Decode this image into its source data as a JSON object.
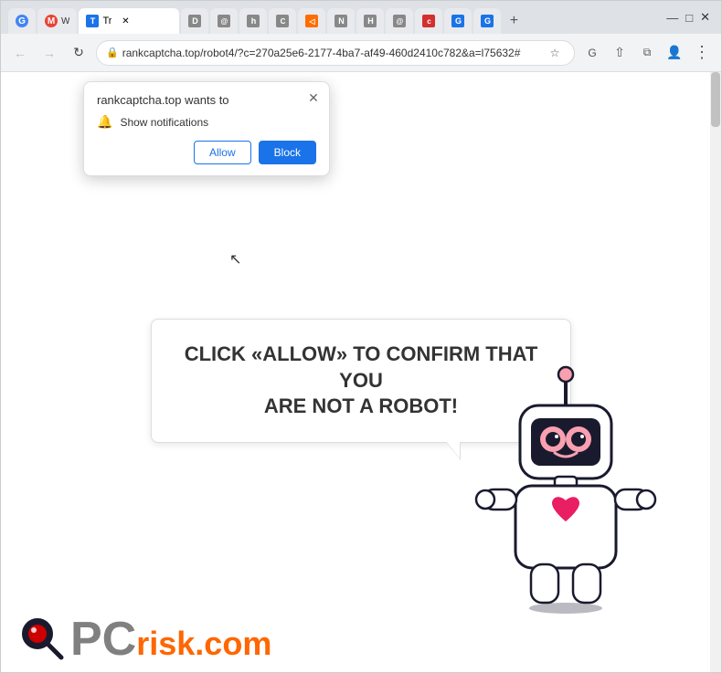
{
  "browser": {
    "tabs": [
      {
        "id": "tab-google",
        "label": "G W",
        "favicon": "G",
        "fav_type": "fav-g",
        "active": false
      },
      {
        "id": "tab-mw",
        "label": "M W",
        "favicon": "M",
        "fav_type": "fav-m",
        "active": false
      },
      {
        "id": "tab-active",
        "label": "Tr",
        "favicon": "T",
        "fav_type": "fav-blue",
        "active": true,
        "has_close": true
      },
      {
        "id": "tab-d",
        "label": "D",
        "favicon": "D",
        "fav_type": "fav-gray",
        "active": false
      },
      {
        "id": "tab-h2",
        "label": "h",
        "favicon": "h",
        "fav_type": "fav-gray",
        "active": false
      },
      {
        "id": "tab-c",
        "label": "C",
        "favicon": "C",
        "fav_type": "fav-gray",
        "active": false
      },
      {
        "id": "tab-tri",
        "label": "◁",
        "favicon": "◁",
        "fav_type": "fav-orange",
        "active": false
      },
      {
        "id": "tab-n",
        "label": "N",
        "favicon": "N",
        "fav_type": "fav-gray",
        "active": false
      },
      {
        "id": "tab-h3",
        "label": "H",
        "favicon": "H",
        "fav_type": "fav-gray",
        "active": false
      },
      {
        "id": "tab-at",
        "label": "@",
        "favicon": "@",
        "fav_type": "fav-gray",
        "active": false
      },
      {
        "id": "tab-c2",
        "label": "c",
        "favicon": "c",
        "fav_type": "fav-red",
        "active": false
      },
      {
        "id": "tab-g",
        "label": "G",
        "favicon": "G",
        "fav_type": "fav-blue",
        "active": false
      },
      {
        "id": "tab-g2",
        "label": "G",
        "favicon": "G",
        "fav_type": "fav-blue",
        "active": false
      }
    ],
    "url": "rankcaptcha.top/robot4/?c=270a25e6-2177-4ba7-af49-460d2410c782&a=l75632#",
    "url_full": "rankcaptcha.top/robot4/?c=270a25e6-2177-4ba7-af49-460d2410c782&a=l75632#",
    "window_controls": {
      "minimize": "—",
      "maximize": "□",
      "close": "✕"
    }
  },
  "popup": {
    "title": "rankcaptcha.top wants to",
    "notification_text": "Show notifications",
    "allow_label": "Allow",
    "block_label": "Block"
  },
  "page": {
    "main_text_line1": "CLICK «ALLOW» TO CONFIRM THAT YOU",
    "main_text_line2": "ARE NOT A ROBOT!"
  },
  "logo": {
    "pc_text": "PC",
    "risk_text": "risk.com"
  },
  "colors": {
    "allow_btn": "#1a73e8",
    "block_btn_bg": "#1a73e8",
    "block_btn_text": "#ffffff",
    "text_main": "#333333",
    "bubble_border": "#dddddd"
  }
}
